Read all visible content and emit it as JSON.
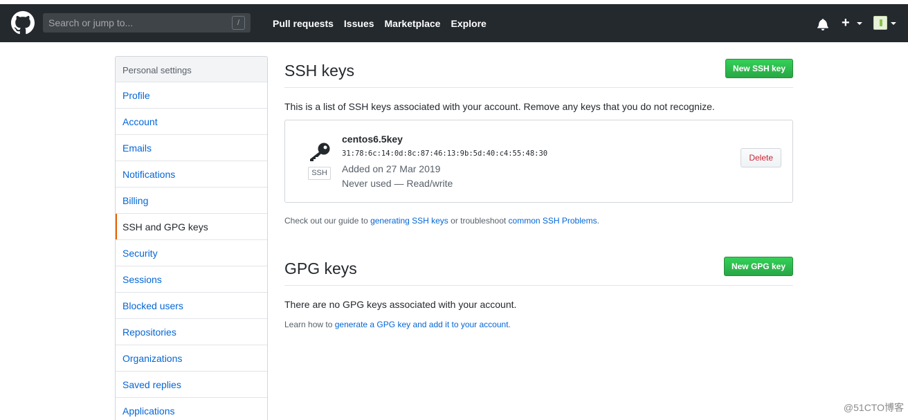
{
  "header": {
    "search_placeholder": "Search or jump to...",
    "search_hotkey": "/",
    "nav": [
      "Pull requests",
      "Issues",
      "Marketplace",
      "Explore"
    ],
    "plus_label": "+"
  },
  "sidebar": {
    "header": "Personal settings",
    "items": [
      {
        "label": "Profile"
      },
      {
        "label": "Account"
      },
      {
        "label": "Emails"
      },
      {
        "label": "Notifications"
      },
      {
        "label": "Billing"
      },
      {
        "label": "SSH and GPG keys",
        "selected": true
      },
      {
        "label": "Security"
      },
      {
        "label": "Sessions"
      },
      {
        "label": "Blocked users"
      },
      {
        "label": "Repositories"
      },
      {
        "label": "Organizations"
      },
      {
        "label": "Saved replies"
      },
      {
        "label": "Applications"
      }
    ]
  },
  "ssh": {
    "title": "SSH keys",
    "new_button": "New SSH key",
    "description": "This is a list of SSH keys associated with your account. Remove any keys that you do not recognize.",
    "key": {
      "name": "centos6.5key",
      "fingerprint": "31:78:6c:14:0d:8c:87:46:13:9b:5d:40:c4:55:48:30",
      "added": "Added on 27 Mar 2019",
      "usage": "Never used — Read/write",
      "type_label": "SSH",
      "delete_button": "Delete"
    },
    "guide_prefix": "Check out our guide to ",
    "guide_link": "generating SSH keys",
    "guide_middle": " or troubleshoot ",
    "guide_link2": "common SSH Problems",
    "guide_suffix": "."
  },
  "gpg": {
    "title": "GPG keys",
    "new_button": "New GPG key",
    "empty_message": "There are no GPG keys associated with your account.",
    "learn_prefix": "Learn how to ",
    "learn_link": "generate a GPG key and add it to your account",
    "learn_suffix": "."
  },
  "watermark": "@51CTO博客",
  "colors": {
    "header_bg": "#24292e",
    "link": "#0366d6",
    "green": "#28a745",
    "danger": "#cb2431",
    "selected_accent": "#e36209"
  }
}
